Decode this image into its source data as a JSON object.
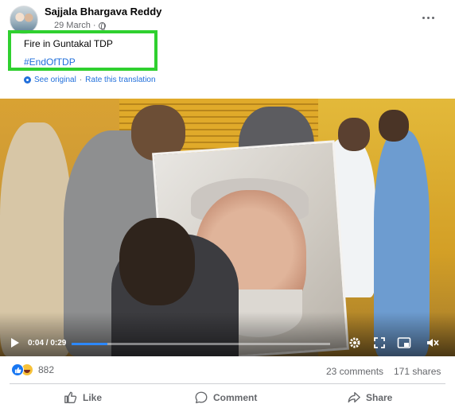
{
  "post": {
    "author": "Sajjala Bhargava Reddy",
    "date": "29 March",
    "date_separator": "·",
    "caption": "Fire in Guntakal TDP",
    "hashtag": "#EndOfTDP",
    "see_original": "See original",
    "translate_separator": "·",
    "rate_translation": "Rate this translation",
    "icons": {
      "audience": "globe-icon",
      "more": "more-horizontal-icon",
      "translation": "gear-icon"
    }
  },
  "video": {
    "time": "0:04 / 0:29",
    "progress": 0.138,
    "icons": [
      "play-icon",
      "settings-icon",
      "fullscreen-icon",
      "picture-in-picture-icon",
      "volume-icon"
    ]
  },
  "stats": {
    "reaction_count": "882",
    "comments": "23 comments",
    "shares": "171 shares",
    "reaction_icons": [
      "like-reaction-icon",
      "haha-reaction-icon"
    ]
  },
  "actions": {
    "like": "Like",
    "comment": "Comment",
    "share": "Share"
  },
  "colors": {
    "highlight_border": "#2fd02f",
    "link": "#216fdb",
    "secondary_text": "#65676b",
    "progress": "#2d88ff",
    "like_blue": "#1877f2"
  }
}
